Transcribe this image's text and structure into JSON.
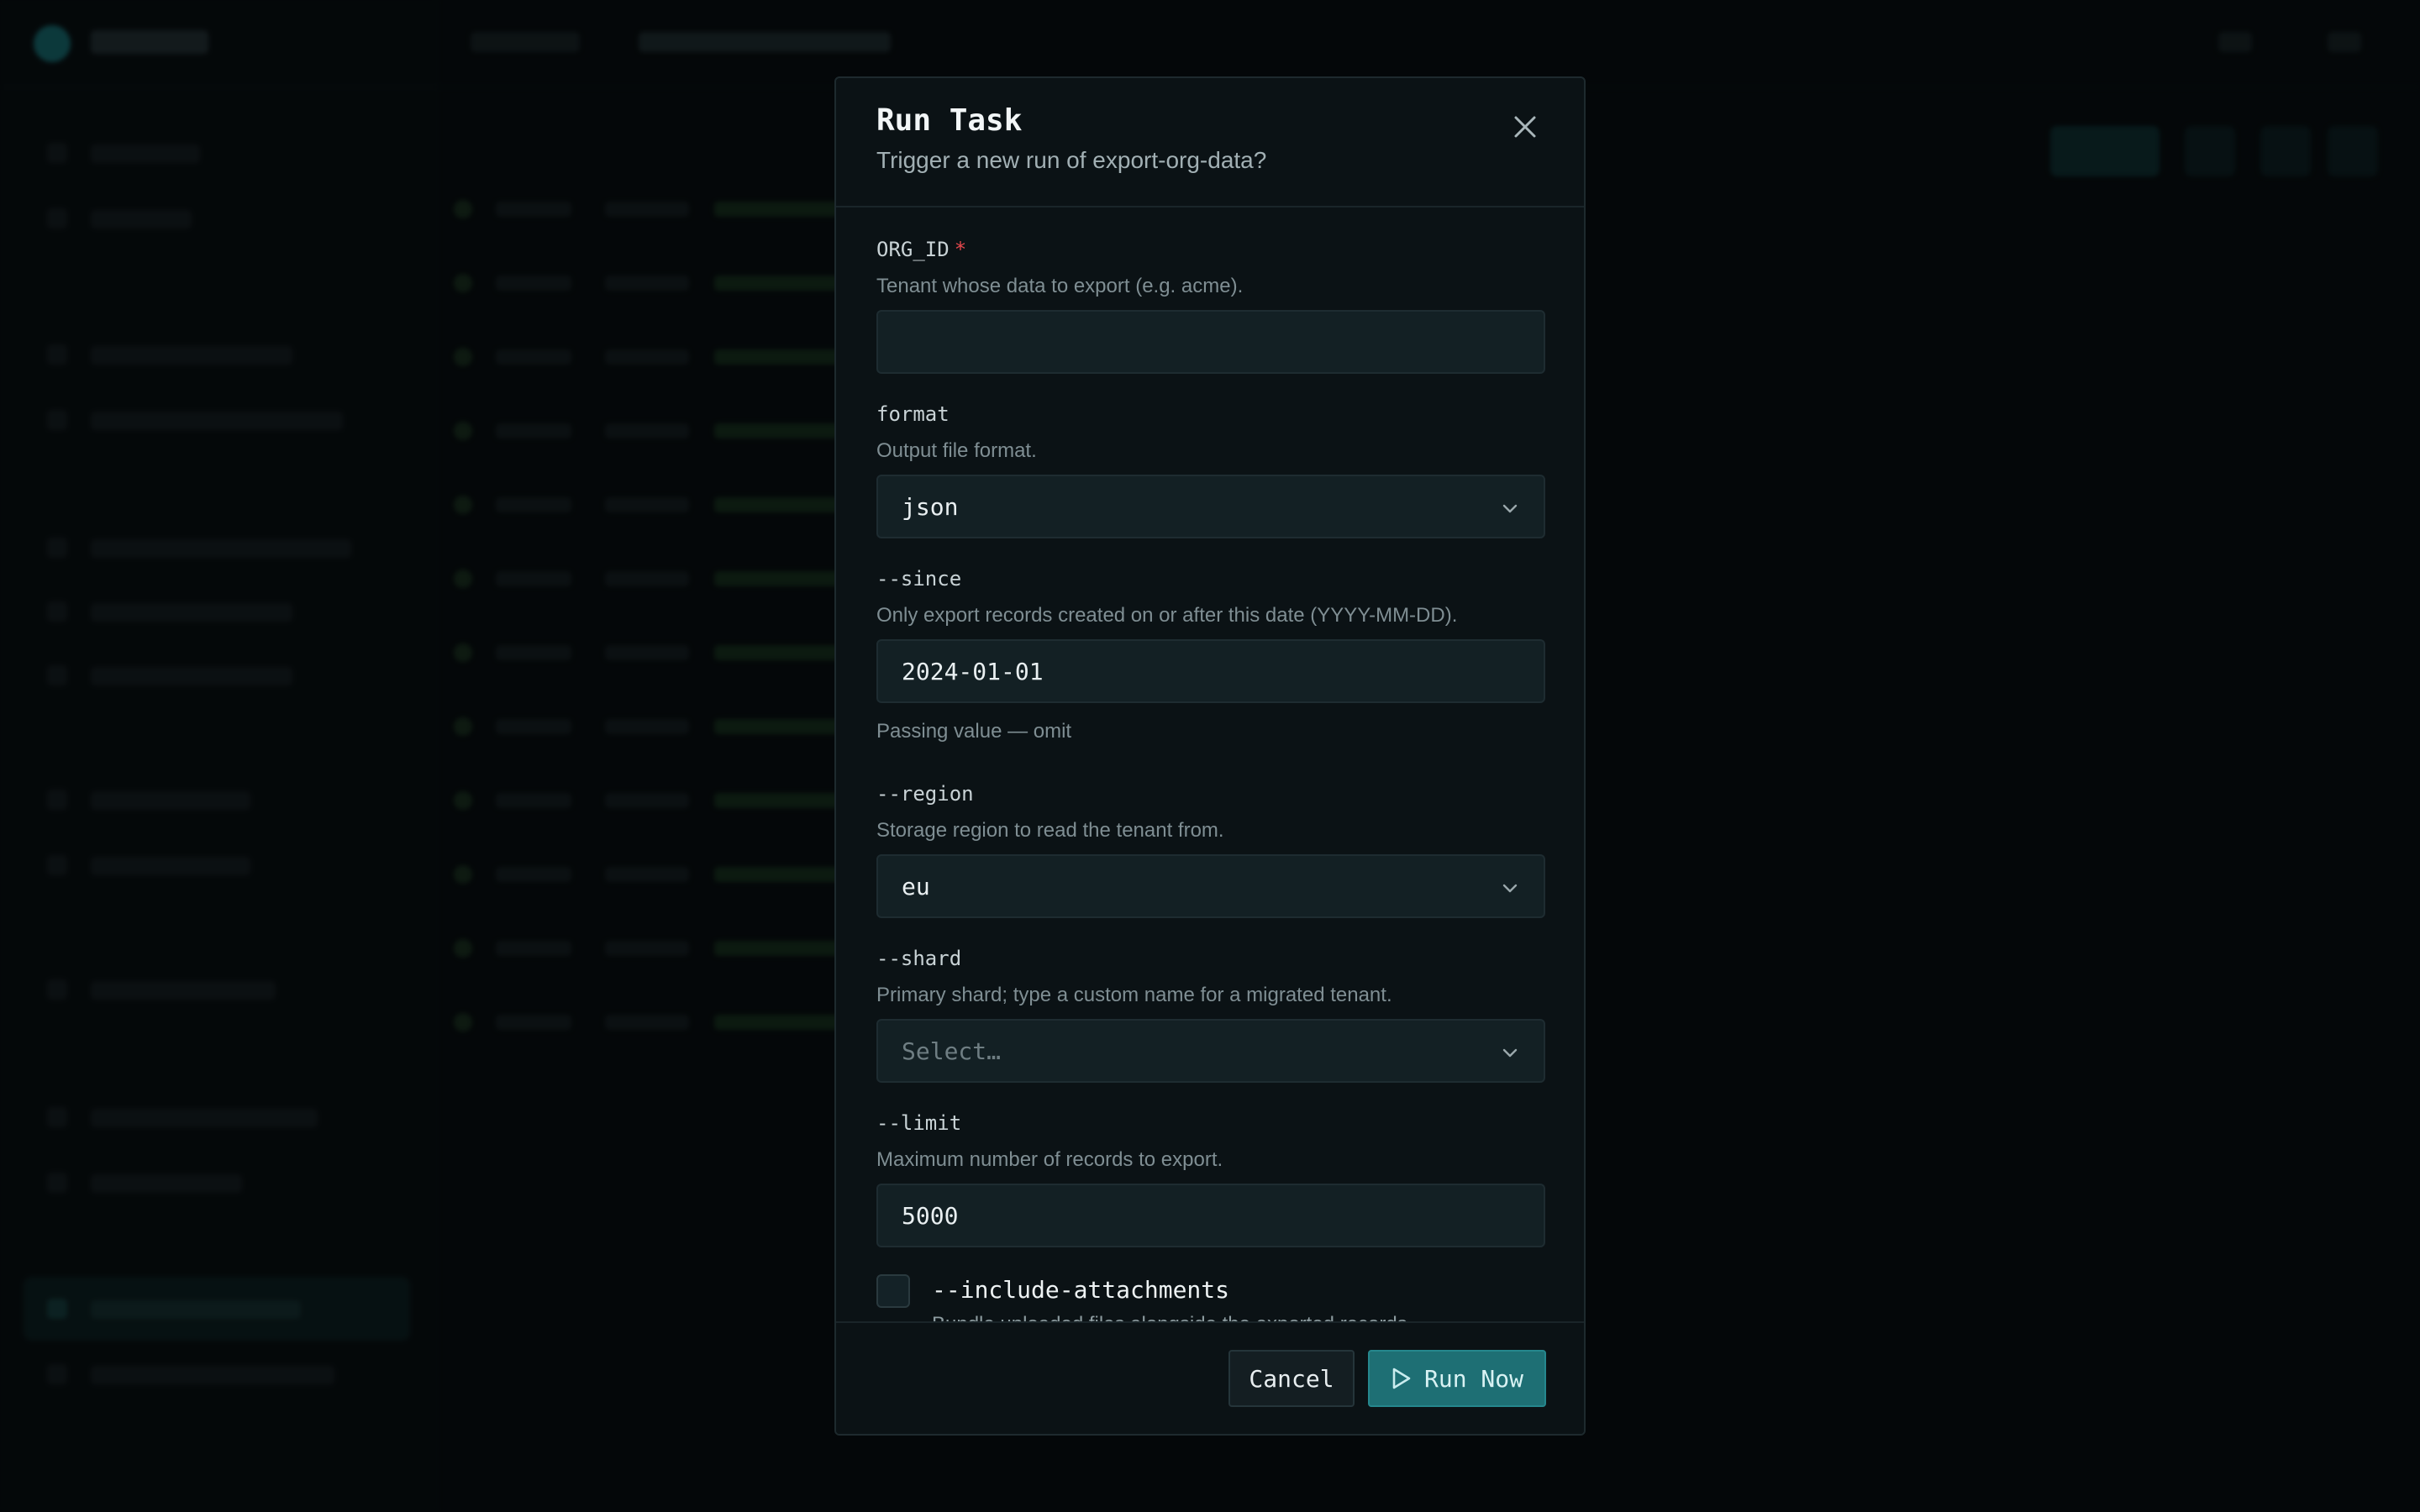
{
  "modal": {
    "title": "Run Task",
    "subtitle": "Trigger a new run of export-org-data?",
    "fields": {
      "org_id": {
        "label": "ORG_ID",
        "required_mark": "*",
        "description": "Tenant whose data to export (e.g. acme).",
        "value": ""
      },
      "format": {
        "label": "format",
        "description": "Output file format.",
        "value": "json"
      },
      "since": {
        "label": "--since",
        "description": "Only export records created on or after this date (YYYY-MM-DD).",
        "value": "2024-01-01",
        "hint": "Passing value — omit"
      },
      "region": {
        "label": "--region",
        "description": "Storage region to read the tenant from.",
        "value": "eu"
      },
      "shard": {
        "label": "--shard",
        "description": "Primary shard; type a custom name for a migrated tenant.",
        "placeholder": "Select…"
      },
      "limit": {
        "label": "--limit",
        "description": "Maximum number of records to export.",
        "value": "5000"
      },
      "include_attachments": {
        "label": "--include-attachments",
        "description": "Bundle uploaded files alongside the exported records.",
        "checked": false
      }
    },
    "footer": {
      "cancel_label": "Cancel",
      "run_label": "Run Now"
    }
  },
  "colors": {
    "accent": "#1e6f74",
    "required": "#e5484d"
  },
  "icons": {
    "close": "close-icon",
    "chevron": "chevron-down-icon",
    "play": "play-icon"
  }
}
